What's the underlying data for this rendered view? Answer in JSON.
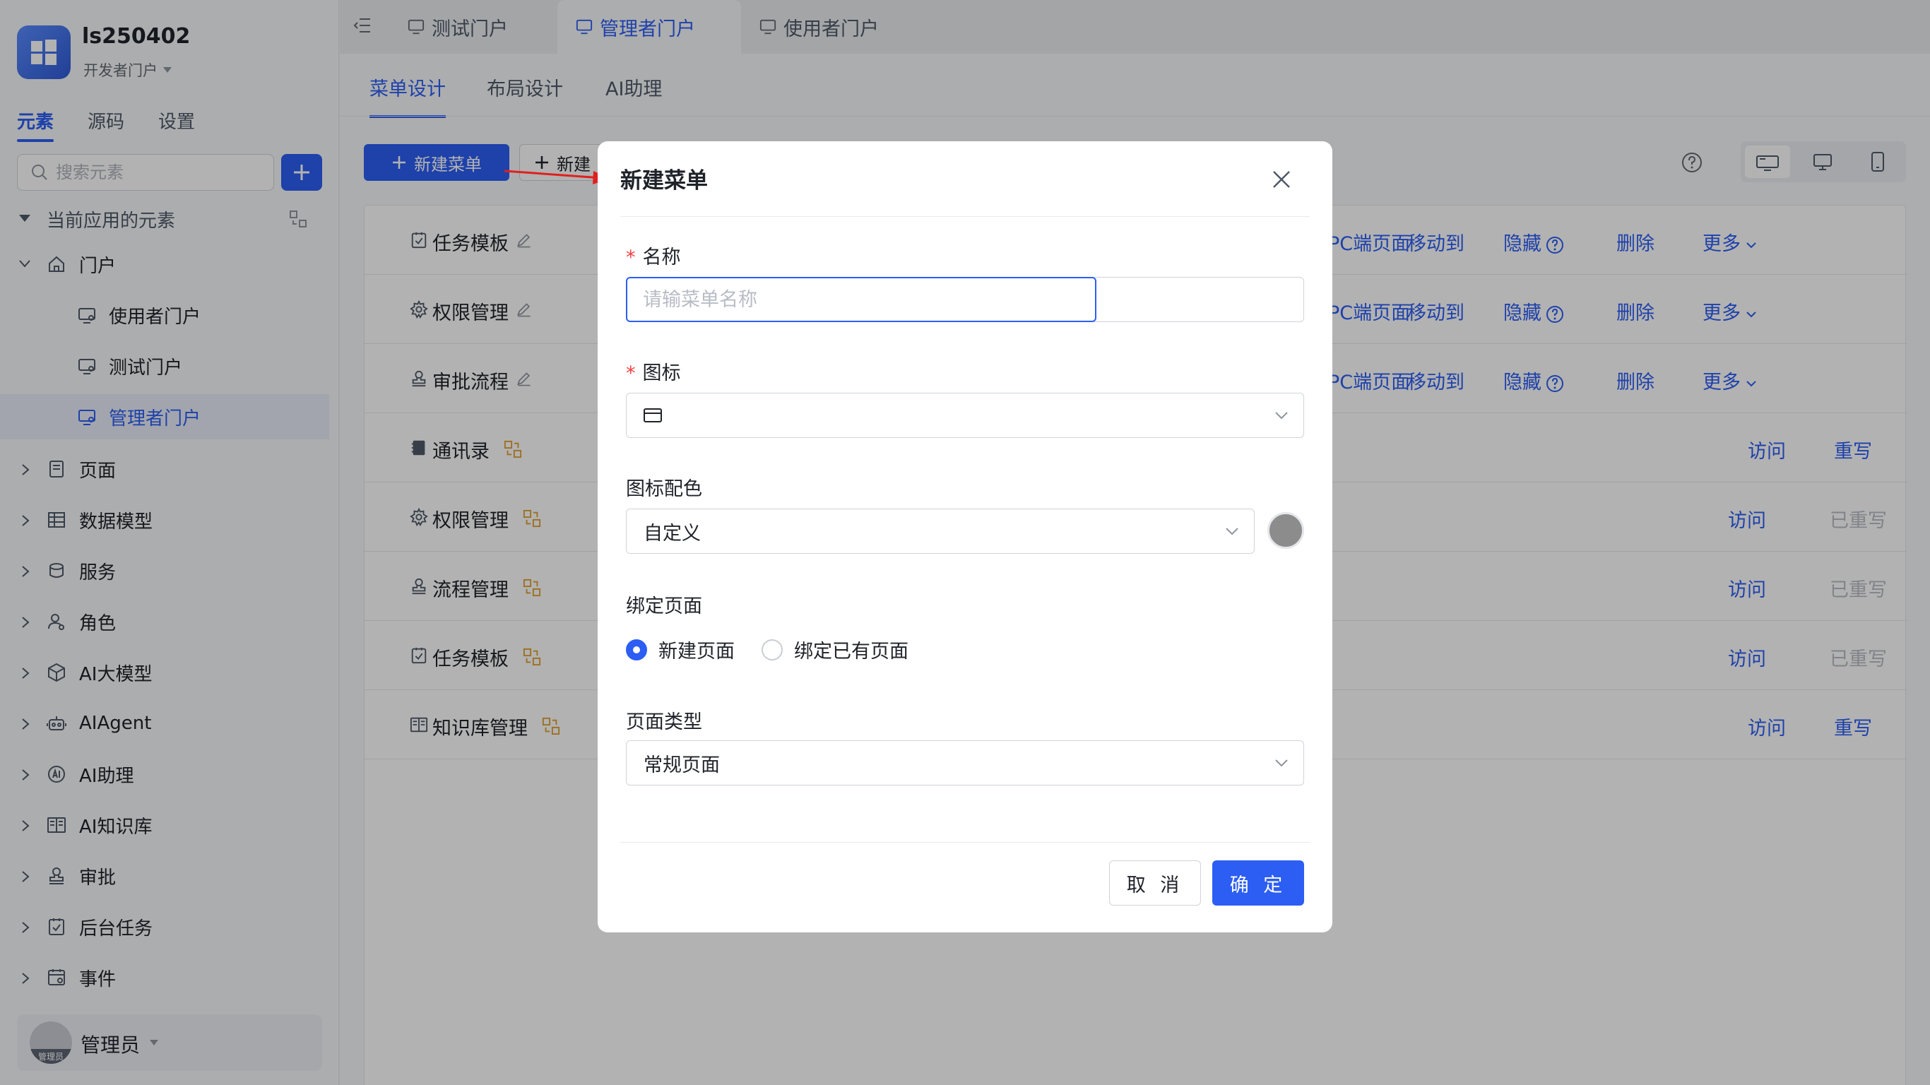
{
  "app": {
    "name": "ls250402",
    "portal": "开发者门户"
  },
  "sidebar": {
    "tabs": [
      "元素",
      "源码",
      "设置"
    ],
    "search_placeholder": "搜索元素",
    "section_title": "当前应用的元素",
    "tree": [
      {
        "label": "门户",
        "icon": "home-icon"
      },
      {
        "label": "使用者门户",
        "icon": "portal-icon"
      },
      {
        "label": "测试门户",
        "icon": "portal-icon"
      },
      {
        "label": "管理者门户",
        "icon": "portal-icon"
      },
      {
        "label": "页面",
        "icon": "page-icon"
      },
      {
        "label": "数据模型",
        "icon": "table-icon"
      },
      {
        "label": "服务",
        "icon": "service-icon"
      },
      {
        "label": "角色",
        "icon": "role-icon"
      },
      {
        "label": "AI大模型",
        "icon": "model-icon"
      },
      {
        "label": "AIAgent",
        "icon": "robot-icon"
      },
      {
        "label": "AI助理",
        "icon": "assistant-icon"
      },
      {
        "label": "AI知识库",
        "icon": "book-icon"
      },
      {
        "label": "审批",
        "icon": "stamp-icon"
      },
      {
        "label": "后台任务",
        "icon": "task-icon"
      },
      {
        "label": "事件",
        "icon": "event-icon"
      }
    ],
    "user": {
      "name": "管理员",
      "avatar_text": "管理员"
    }
  },
  "top_tabs": [
    "测试门户",
    "管理者门户",
    "使用者门户"
  ],
  "sub_tabs": [
    "菜单设计",
    "布局设计",
    "AI助理"
  ],
  "toolbar": {
    "new_menu": "新建菜单",
    "new_other": "新建"
  },
  "rows": [
    {
      "name": "任务模板",
      "actions": [
        "设计PC端页面",
        "移动到",
        "隐藏",
        "删除",
        "更多"
      ]
    },
    {
      "name": "权限管理",
      "actions": [
        "设计PC端页面",
        "移动到",
        "隐藏",
        "删除",
        "更多"
      ]
    },
    {
      "name": "审批流程",
      "actions": [
        "设计PC端页面",
        "移动到",
        "隐藏",
        "删除",
        "更多"
      ]
    },
    {
      "name": "通讯录",
      "actions": [
        "访问",
        "重写"
      ]
    },
    {
      "name": "权限管理",
      "actions": [
        "访问",
        "已重写"
      ]
    },
    {
      "name": "流程管理",
      "actions": [
        "访问",
        "已重写"
      ]
    },
    {
      "name": "任务模板",
      "actions": [
        "访问",
        "已重写"
      ]
    },
    {
      "name": "知识库管理",
      "actions": [
        "访问",
        "重写"
      ]
    }
  ],
  "dialog": {
    "title": "新建菜单",
    "name_label": "名称",
    "name_placeholder": "请输菜单名称",
    "name_value": "",
    "icon_label": "图标",
    "color_label": "图标配色",
    "color_value": "自定义",
    "bind_label": "绑定页面",
    "bind_options": [
      "新建页面",
      "绑定已有页面"
    ],
    "type_label": "页面类型",
    "type_value": "常规页面",
    "cancel": "取 消",
    "ok": "确 定"
  },
  "colors": {
    "primary": "#2c5ef4",
    "danger": "#f53f3f",
    "icon_color": "#8c8c8c"
  }
}
